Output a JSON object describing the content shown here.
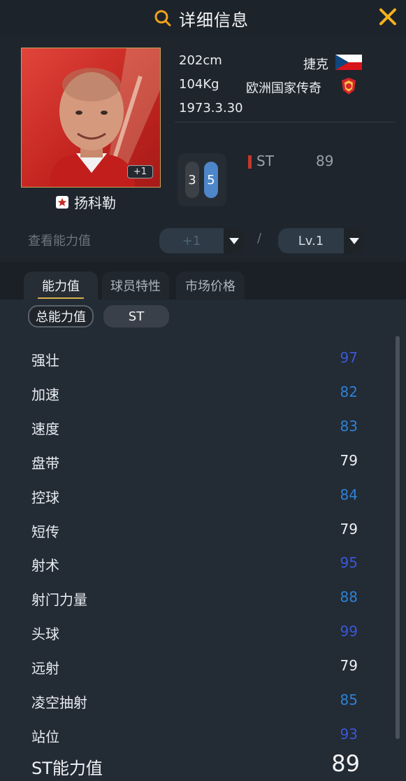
{
  "header": {
    "title": "详细信息"
  },
  "player": {
    "height": "202cm",
    "weight": "104Kg",
    "birthdate": "1973.3.30",
    "nation": "捷克",
    "category": "欧洲国家传奇",
    "upgrade_badge": "+1",
    "name": "扬科勒",
    "foot_left": "3",
    "foot_right": "5",
    "position": "ST",
    "position_rating": "89"
  },
  "filters": {
    "label": "查看能力值",
    "upgrade_value": "+1",
    "slash": "/",
    "level_value": "Lv.1"
  },
  "tabs": [
    {
      "label": "能力值",
      "active": true
    },
    {
      "label": "球员特性",
      "active": false
    },
    {
      "label": "市场价格",
      "active": false
    }
  ],
  "chips": {
    "total": "总能力值",
    "position": "ST"
  },
  "colors": {
    "value_blue": "#2e82d6",
    "value_white": "#eef1f4",
    "value_indigo": "#3a58d6",
    "accent_yellow": "#f5b11d"
  },
  "stats": [
    {
      "label": "强壮",
      "value": "97",
      "color": "#3a58d6"
    },
    {
      "label": "加速",
      "value": "82",
      "color": "#2e82d6"
    },
    {
      "label": "速度",
      "value": "83",
      "color": "#2e82d6"
    },
    {
      "label": "盘带",
      "value": "79",
      "color": "#eef1f4"
    },
    {
      "label": "控球",
      "value": "84",
      "color": "#2e82d6"
    },
    {
      "label": "短传",
      "value": "79",
      "color": "#eef1f4"
    },
    {
      "label": "射术",
      "value": "95",
      "color": "#3a58d6"
    },
    {
      "label": "射门力量",
      "value": "88",
      "color": "#2e82d6"
    },
    {
      "label": "头球",
      "value": "99",
      "color": "#3a58d6"
    },
    {
      "label": "远射",
      "value": "79",
      "color": "#eef1f4"
    },
    {
      "label": "凌空抽射",
      "value": "85",
      "color": "#2e82d6"
    },
    {
      "label": "站位",
      "value": "93",
      "color": "#3a58d6"
    }
  ],
  "summary": {
    "label": "ST能力值",
    "value": "89"
  }
}
